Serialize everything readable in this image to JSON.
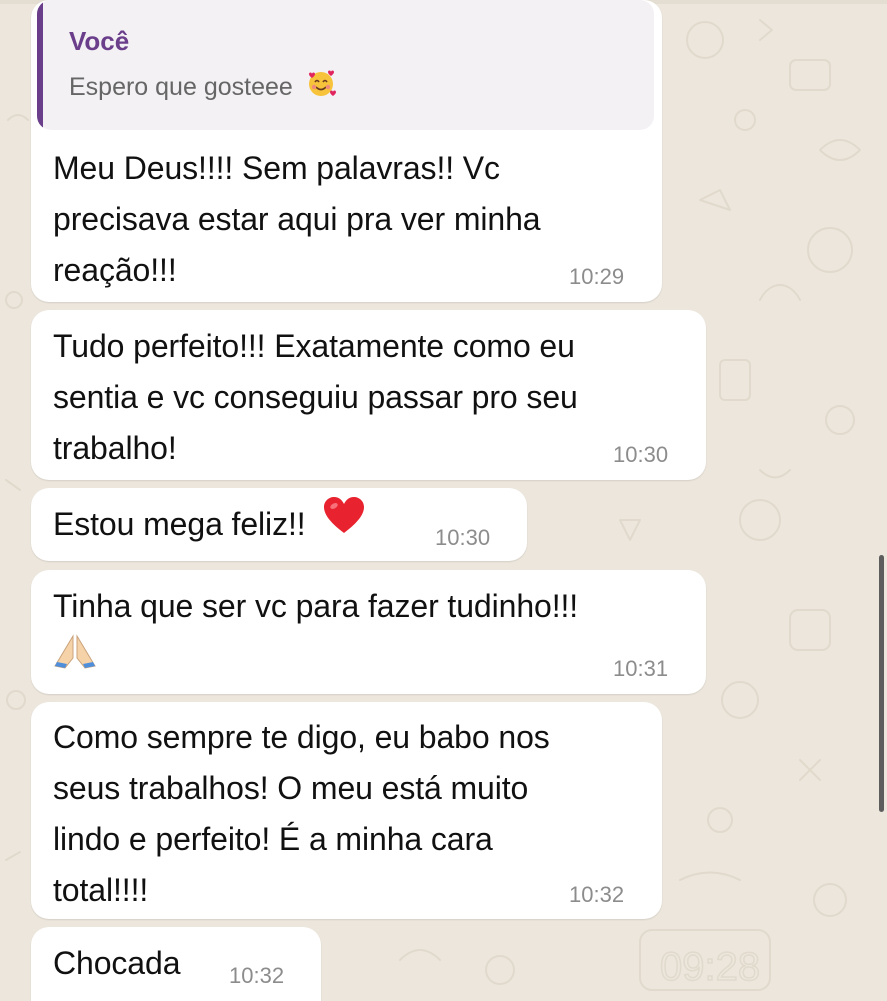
{
  "chat": {
    "reply": {
      "author": "Você",
      "quote": "Espero que gosteee",
      "quote_emoji": "smiling-face-with-hearts"
    },
    "messages": [
      {
        "lines": [
          "Meu Deus!!!! Sem palavras!! Vc",
          "precisava estar aqui pra ver minha",
          "reação!!!"
        ],
        "time": "10:29"
      },
      {
        "lines": [
          "Tudo perfeito!!! Exatamente como eu",
          "sentia e vc conseguiu passar pro seu",
          "trabalho!"
        ],
        "time": "10:30"
      },
      {
        "lines": [
          "Estou mega feliz!!"
        ],
        "emoji": "red-heart",
        "time": "10:30"
      },
      {
        "lines": [
          "Tinha que ser vc para fazer tudinho!!!"
        ],
        "emoji": "folded-hands",
        "time": "10:31"
      },
      {
        "lines": [
          "Como sempre te digo, eu babo nos",
          "seus trabalhos! O meu está muito",
          "lindo e perfeito! É a minha cara",
          "total!!!!"
        ],
        "time": "10:32"
      },
      {
        "lines": [
          "Chocada"
        ],
        "time": "10:32"
      }
    ]
  },
  "colors": {
    "background": "#ECE6DC",
    "bubble": "#FFFFFF",
    "reply_accent": "#6A3E8A",
    "timestamp": "#8C8C8C"
  }
}
